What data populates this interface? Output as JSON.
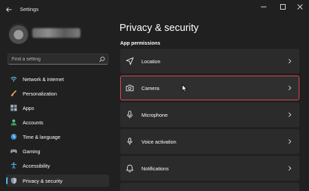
{
  "window": {
    "title": "Settings",
    "controls": [
      "minimize",
      "maximize",
      "close"
    ]
  },
  "sidebar": {
    "search": {
      "placeholder": "Find a setting",
      "value": ""
    },
    "items": [
      {
        "label": "Network & internet",
        "icon": "wifi-icon",
        "selected": false
      },
      {
        "label": "Personalization",
        "icon": "paintbrush-icon",
        "selected": false
      },
      {
        "label": "Apps",
        "icon": "apps-icon",
        "selected": false
      },
      {
        "label": "Accounts",
        "icon": "person-icon",
        "selected": false
      },
      {
        "label": "Time & language",
        "icon": "globe-clock-icon",
        "selected": false
      },
      {
        "label": "Gaming",
        "icon": "gamepad-icon",
        "selected": false
      },
      {
        "label": "Accessibility",
        "icon": "accessibility-icon",
        "selected": false
      },
      {
        "label": "Privacy & security",
        "icon": "shield-icon",
        "selected": true
      }
    ]
  },
  "main": {
    "title": "Privacy & security",
    "section": "App permissions",
    "permissions": [
      {
        "label": "Location",
        "icon": "location-arrow-icon",
        "highlighted": false
      },
      {
        "label": "Camera",
        "icon": "camera-icon",
        "highlighted": true
      },
      {
        "label": "Microphone",
        "icon": "microphone-icon",
        "highlighted": false
      },
      {
        "label": "Voice activation",
        "icon": "voice-activation-icon",
        "highlighted": false
      },
      {
        "label": "Notifications",
        "icon": "bell-icon",
        "highlighted": false
      }
    ]
  },
  "colors": {
    "background": "#202020",
    "card": "#2b2b2b",
    "accent": "#4cc2ff",
    "highlight_border": "#e8475a"
  }
}
